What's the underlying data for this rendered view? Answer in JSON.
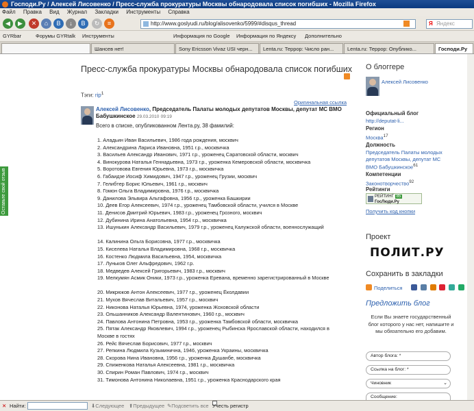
{
  "window": {
    "title": "Господи.Ру / Алексей Лисовенко / Пресс-служба прокуратуры Москвы обнародовала список погибших - Mozilla Firefox"
  },
  "menu": [
    "Файл",
    "Правка",
    "Вид",
    "Журнал",
    "Закладки",
    "Инструменты",
    "Справка"
  ],
  "nav": {
    "url": "http://www.goslyudi.ru/blog/alisovenko/5999/#disqus_thread",
    "search_placeholder": "Яндекс",
    "search_logo": "Я"
  },
  "toolbar": {
    "gyrbar": "GYRbar",
    "forums": "Форумы GYRtalk",
    "tools": "Инструменты",
    "google_info": "Информация по Google",
    "yandex_info": "Информация по Яндексу",
    "extra": "Дополнительно"
  },
  "tabs": [
    "Шансев нет!",
    "Sony Ericsson Vivaz USI черн...",
    "Lenta.ru: Террор: Число ран...",
    "Lenta.ru: Террор: Опублико...",
    "Господи.Ру"
  ],
  "sidetab": "Оставьте свой отзыв",
  "post": {
    "title": "Пресс-служба прокуратуры Москвы обнародовала список погибших",
    "tags_label": "Тэги:",
    "tag": "rip",
    "tag_count": "1",
    "original_link": "Оригинальная ссылка",
    "author": "Алексей Лисовенко",
    "author_role": ", Председатель Палаты молодых депутатов Москвы, депутат МС ВМО Бабушкинское",
    "date": "29.03.2010",
    "time": "09:19",
    "total": "Всего в списке, опубликованном Лента.ру, 38 фамилий:",
    "list": [
      "1. Аладьин Иван Васильевич, 1986 года рождения, москвич",
      "2. Александрина Лариса Ивановна, 1951 г.р., москвичка",
      "3. Васильев Александр Иванович, 1971 г.р., уроженец Саратовской области, москвич",
      "4. Винокурова Наталья Геннадьевна, 1973 г.р., уроженка Кемеровской области, москвичка",
      "5. Воротовова Евгения Юрьевна, 1973 г.р., москвичка",
      "6. Габаидзе Иосиф Химидович, 1947 г.р., уроженец Грузии, москвич",
      "7. Гелибтер Борис Юльевич, 1961 г.р., москвич",
      "8. Гомон Ольга Владимировна, 1976 г.р., москвичка",
      "9. Данилова Эльвира Альтафовна, 1956 г.р., уроженка Башкирии",
      "10. Деев Егор Алексеевич, 1974 г.р., уроженец Тамбовской области, учился в Москве",
      "11. Денисов Дмитрий Юрьевич, 1983 г.р., уроженец Грозного, москвич",
      "12. Дубинина Ирина Анатольевна, 1954 г.р., москвичка",
      "13. Ишунькин Александр Васильевич, 1979 г.р., уроженец Калужской области, военнослужащий",
      "14. Калинина Ольга Борисовна, 1977 г.р., москвичка",
      "15. Киселева Наталья Владимировна, 1968 г.р., москвичка",
      "16. Костенко Людмила Васильевна, 1954, москвичка",
      "17. Луньков Олег Альфредович, 1962 г.р.",
      "18. Медведев Алексей Григорьевич, 1983 г.р., москвич",
      "19. Мелкумян Асмик Оники, 1973 г.р., уроженка Еревана, временно зарегистрированный в Москве",
      "20. Микрюков Антон Алексеевич, 1977 г.р., уроженец Ёколдавии",
      "21. Мухов Вячеслав Витальевич, 1957 г.р., москвич",
      "22. Никонова Наталья Юрьевна, 1974, уроженка Жоховской области",
      "23. Ольшанников Александр Валентинович, 1960 г.р., москвич",
      "24. Павлова Антонина Петровна, 1953 г.р., уроженка Тамбовской области, москвичка",
      "25. Пятак Александр Яковлевич, 1994 г.р., уроженец Рыбинска Ярославской области, находился в Москве в гостях",
      "26. Рейс Вячеслав Борисович, 1977 г.р., москвич",
      "27. Репкина Людмила Кузьминична, 1946, уроженка Украины, москвичка",
      "28. Скорова Нина Ивановна, 1956 г.р., уроженка Душанбе, москвичка",
      "29. Спиженкова Наталья Алексеевна, 1981 г.р., москвичка",
      "30. Спирин Роман Павлович, 1974 г.р., москвич",
      "31. Тимонова Антонина Николаевна, 1951 г.р., уроженка Краснодарского края"
    ]
  },
  "sidebar": {
    "about": "О блоггере",
    "blogger": "Алексей Лисовенко",
    "official_blog_label": "Официальный блог",
    "official_blog_link": "http://deputat-li...",
    "region_label": "Регион",
    "region": "Москва",
    "region_count": "17",
    "position_label": "Должность",
    "position": "Председатель Палаты молодых депутатов Москвы, депутат МС ВМО Бабушкинское",
    "position_count": "61",
    "competence_label": "Компетенции",
    "competence": "Законотворчество",
    "competence_count": "92",
    "rating_label": "Рейтинги",
    "rating_text": "РЕЙТИНГ",
    "rating_value": "85",
    "rating_site": "ГосЛюди.Ру",
    "get_button": "Получить код кнопки",
    "project": "Проект",
    "politru": "ПОЛИТ.РУ",
    "bookmarks": "Сохранить в закладки",
    "share": "Поделиться",
    "propose": "Предложить блог",
    "propose_text": "Если Вы знаете государственный блог которого у нас нет, напишите и мы обязательно его добавим.",
    "field_author": "Автор блога: *",
    "field_link": "Ссылка на блог: *",
    "field_role": "Чиновник",
    "field_msg": "Сообщение:"
  },
  "findbar": {
    "label": "Найти:",
    "next": "Следующее",
    "prev": "Предыдущее",
    "highlight": "Подсветить все",
    "matchcase": "Учесть регистр"
  }
}
